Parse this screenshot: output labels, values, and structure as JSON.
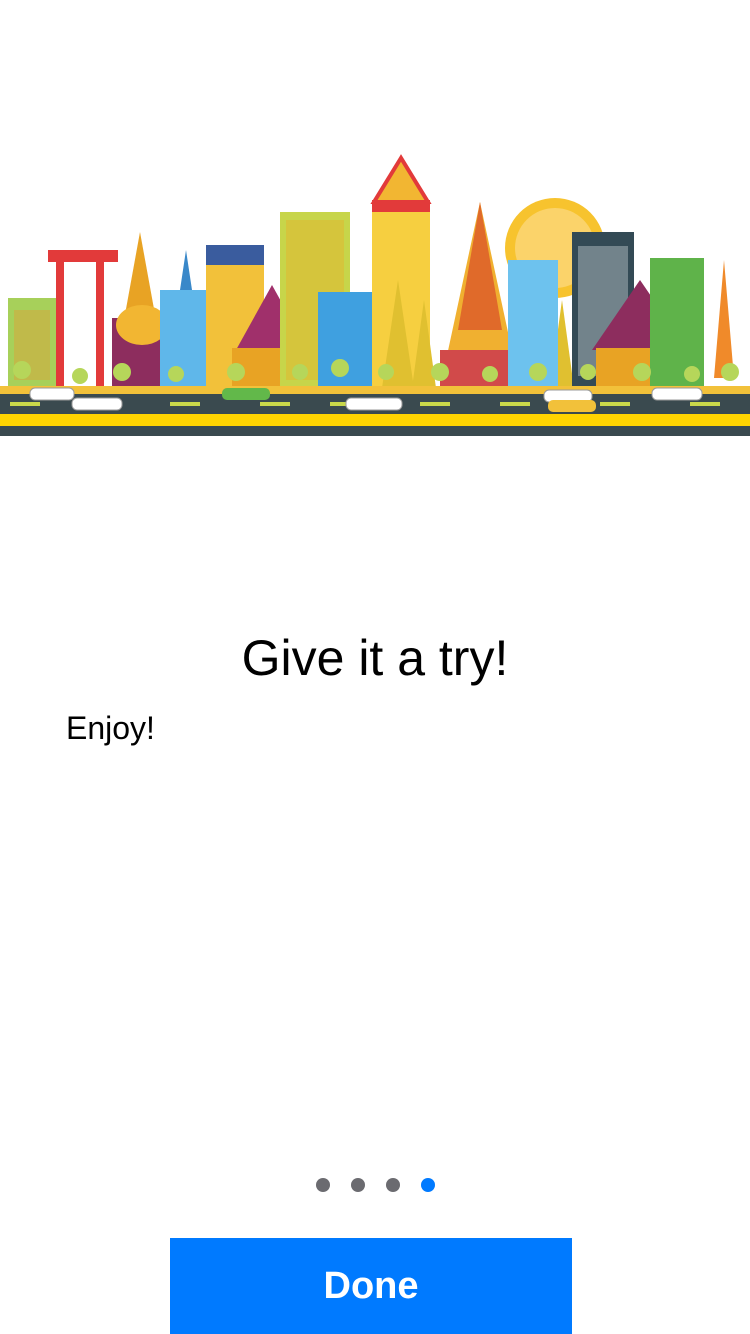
{
  "hero": {
    "image_name": "bangkok-skyline-illustration"
  },
  "onboarding": {
    "title": "Give it a try!",
    "subtitle": "Enjoy!"
  },
  "pager": {
    "total": 4,
    "current": 4
  },
  "footer": {
    "done_label": "Done"
  },
  "colors": {
    "accent": "#007aff",
    "dot_inactive": "#6b6b70",
    "road": "#3a4a4f",
    "road_line": "#ffd400"
  }
}
